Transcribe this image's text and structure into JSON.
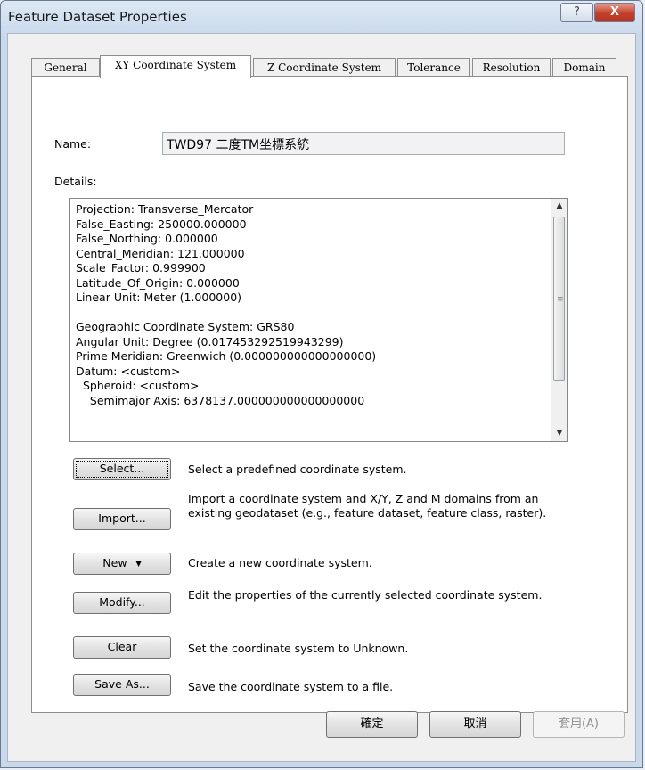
{
  "window": {
    "title": "Feature Dataset Properties",
    "help_glyph": "?",
    "close_glyph": "X"
  },
  "tabs": [
    {
      "label": "General",
      "active": false
    },
    {
      "label": "XY Coordinate System",
      "active": true
    },
    {
      "label": "Z Coordinate System",
      "active": false
    },
    {
      "label": "Tolerance",
      "active": false
    },
    {
      "label": "Resolution",
      "active": false
    },
    {
      "label": "Domain",
      "active": false
    }
  ],
  "name_field": {
    "label": "Name:",
    "value": "TWD97 二度TM坐標系統"
  },
  "details": {
    "label": "Details:",
    "text": "Projection: Transverse_Mercator\nFalse_Easting: 250000.000000\nFalse_Northing: 0.000000\nCentral_Meridian: 121.000000\nScale_Factor: 0.999900\nLatitude_Of_Origin: 0.000000\nLinear Unit: Meter (1.000000)\n\nGeographic Coordinate System: GRS80\nAngular Unit: Degree (0.017453292519943299)\nPrime Meridian: Greenwich (0.000000000000000000)\nDatum: <custom>\n  Spheroid: <custom>\n    Semimajor Axis: 6378137.000000000000000000",
    "scroll_up": "▲",
    "scroll_down": "▼",
    "grip": "≡"
  },
  "actions": [
    {
      "label": "Select...",
      "description": "Select a predefined coordinate system."
    },
    {
      "label": "Import...",
      "description": "Import a coordinate system and X/Y, Z and M domains from an existing geodataset (e.g., feature dataset, feature class, raster)."
    },
    {
      "label": "New",
      "caret": "▼",
      "description": "Create a new coordinate system."
    },
    {
      "label": "Modify...",
      "description": "Edit the properties of the currently selected coordinate system."
    },
    {
      "label": "Clear",
      "description": "Set the coordinate system to Unknown."
    },
    {
      "label": "Save As...",
      "description": "Save the coordinate system to a file."
    }
  ],
  "footer": {
    "ok": "確定",
    "cancel": "取消",
    "apply": "套用(A)"
  }
}
